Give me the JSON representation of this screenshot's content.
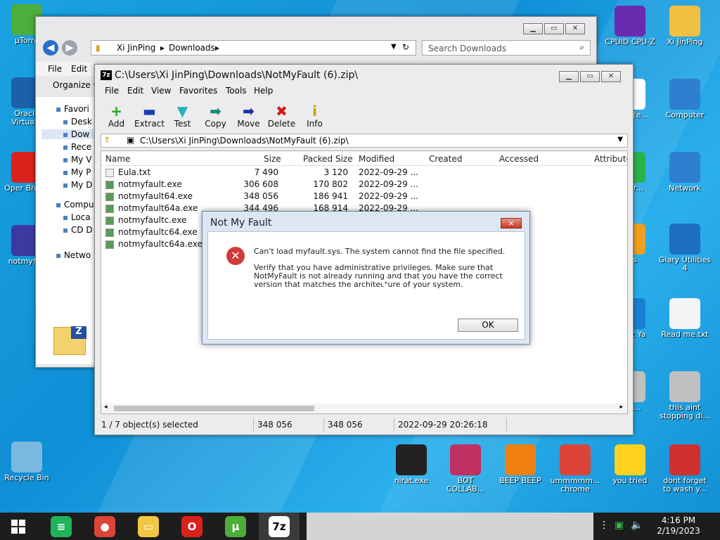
{
  "desktop": {
    "icons_left": [
      {
        "label": "µTorre",
        "icon": "utorrent-icon",
        "color": "#4cae3b"
      },
      {
        "label": "Oracle VirtualB",
        "icon": "virtualbox-icon",
        "color": "#1d5fa8"
      },
      {
        "label": "Oper Brows",
        "icon": "opera-icon",
        "color": "#d9221c"
      },
      {
        "label": "notmyfau",
        "icon": "notmyfault-icon",
        "color": "#3a3aa0"
      },
      {
        "label": "Recycle Bin",
        "icon": "recycle-bin-icon",
        "color": "#7ab8e0"
      }
    ],
    "icons_right": [
      {
        "label": "CPUID CPU-Z",
        "icon": "cpuz-icon",
        "color": "#6a2bb0"
      },
      {
        "label": "Xi JinPing",
        "icon": "user-folder-icon",
        "color": "#f0c040"
      },
      {
        "label": "ware te...",
        "icon": "software-icon",
        "color": "#ffffff"
      },
      {
        "label": "Computer",
        "icon": "computer-icon",
        "color": "#2f7fd0"
      },
      {
        "label": "ed er...",
        "icon": "green-app-icon",
        "color": "#2ab24a"
      },
      {
        "label": "Network",
        "icon": "network-icon",
        "color": "#2f7fd0"
      },
      {
        "label": "this",
        "icon": "orange-app-icon",
        "color": "#f0a020"
      },
      {
        "label": "Glary Utilities 4",
        "icon": "glary-icon",
        "color": "#1d6fc0"
      },
      {
        "label": "at Zit Ya",
        "icon": "blue-app-icon",
        "color": "#1a80d0"
      },
      {
        "label": "Read me.txt",
        "icon": "text-file-icon",
        "color": "#f4f4f4"
      },
      {
        "label": "ULL...",
        "icon": "disc-icon",
        "color": "#c0c0c0"
      },
      {
        "label": "this aint stopping di...",
        "icon": "installer-icon",
        "color": "#c0c0c0"
      }
    ],
    "icons_bottom": [
      {
        "label": "nirat.exe",
        "icon": "skull-icon",
        "color": "#222222"
      },
      {
        "label": "BOT COLLAB...",
        "icon": "bot-collab-icon",
        "color": "#c03060"
      },
      {
        "label": "BEEP BEEP",
        "icon": "vlc-icon",
        "color": "#f08010"
      },
      {
        "label": "ummmmm... chrome",
        "icon": "chrome-icon",
        "color": "#db4437"
      },
      {
        "label": "you tried",
        "icon": "star-icon",
        "color": "#ffd21e"
      },
      {
        "label": "dont forget to wash y...",
        "icon": "ccleaner-icon",
        "color": "#d03030"
      }
    ]
  },
  "explorer": {
    "breadcrumb": [
      "Xi JinPing",
      "Downloads"
    ],
    "search_placeholder": "Search Downloads",
    "menu": [
      "File",
      "Edit"
    ],
    "organize_label": "Organize",
    "nav": [
      {
        "label": "Favori",
        "icon": "star-icon"
      },
      {
        "label": "Desk",
        "icon": "desktop-icon"
      },
      {
        "label": "Dow",
        "icon": "downloads-icon"
      },
      {
        "label": "Rece",
        "icon": "recent-icon"
      },
      {
        "label": "My V",
        "icon": "videos-icon"
      },
      {
        "label": "My P",
        "icon": "pictures-icon"
      },
      {
        "label": "My D",
        "icon": "documents-icon"
      },
      {
        "label": "Compu",
        "icon": "computer-icon"
      },
      {
        "label": "Loca",
        "icon": "drive-icon"
      },
      {
        "label": "CD D",
        "icon": "cd-icon"
      },
      {
        "label": "Netwo",
        "icon": "network-icon"
      }
    ]
  },
  "sevenzip": {
    "title": "C:\\Users\\Xi JinPing\\Downloads\\NotMyFault (6).zip\\",
    "menu": [
      "File",
      "Edit",
      "View",
      "Favorites",
      "Tools",
      "Help"
    ],
    "toolbar": [
      {
        "label": "Add",
        "glyph": "+",
        "color": "#1faa1f",
        "icon": "add-icon"
      },
      {
        "label": "Extract",
        "glyph": "▬",
        "color": "#1a3fb0",
        "icon": "extract-icon"
      },
      {
        "label": "Test",
        "glyph": "▼",
        "color": "#2ab0c0",
        "icon": "test-icon"
      },
      {
        "label": "Copy",
        "glyph": "➡",
        "color": "#1a8a7a",
        "icon": "copy-icon"
      },
      {
        "label": "Move",
        "glyph": "➡",
        "color": "#1a2fa0",
        "icon": "move-icon"
      },
      {
        "label": "Delete",
        "glyph": "✖",
        "color": "#d01818",
        "icon": "delete-icon"
      },
      {
        "label": "Info",
        "glyph": "i",
        "color": "#c8a000",
        "icon": "info-icon"
      }
    ],
    "path": "C:\\Users\\Xi JinPing\\Downloads\\NotMyFault (6).zip\\",
    "columns": [
      "Name",
      "Size",
      "Packed Size",
      "Modified",
      "Created",
      "Accessed",
      "Attribute"
    ],
    "rows": [
      {
        "name": "Eula.txt",
        "size": "7 490",
        "packed": "3 120",
        "modified": "2022-09-29 ..."
      },
      {
        "name": "notmyfault.exe",
        "size": "306 608",
        "packed": "170 802",
        "modified": "2022-09-29 ..."
      },
      {
        "name": "notmyfault64.exe",
        "size": "348 056",
        "packed": "186 941",
        "modified": "2022-09-29 ..."
      },
      {
        "name": "notmyfault64a.exe",
        "size": "344 496",
        "packed": "168 914",
        "modified": "2022-09-29 ..."
      },
      {
        "name": "notmyfaultc.exe",
        "size": "",
        "packed": "",
        "modified": ""
      },
      {
        "name": "notmyfaultc64.exe",
        "size": "",
        "packed": "",
        "modified": ""
      },
      {
        "name": "notmyfaultc64a.exe",
        "size": "",
        "packed": "",
        "modified": ""
      }
    ],
    "status": {
      "selected": "1 / 7 object(s) selected",
      "size": "348 056",
      "packed": "348 056",
      "modified": "2022-09-29 20:26:18"
    }
  },
  "dialog": {
    "title": "Not My Fault",
    "message1": "Can't load myfault.sys. The system cannot find the file specified.",
    "message2": "Verify that you have administrative privileges. Make sure that NotMyFault is not already running and that you have the correct version that matches the architecture of your system.",
    "ok_label": "OK",
    "close_glyph": "✕"
  },
  "taskbar": {
    "clock_time": "4:16 PM",
    "clock_date": "2/19/2023",
    "apps": [
      {
        "name": "sheets-app",
        "color": "#1fb45a",
        "glyph": "≡"
      },
      {
        "name": "chrome-app",
        "color": "#db4437",
        "glyph": "●"
      },
      {
        "name": "explorer-app",
        "color": "#f2c744",
        "glyph": "▭"
      },
      {
        "name": "opera-app",
        "color": "#d9221c",
        "glyph": "O"
      },
      {
        "name": "utorrent-app",
        "color": "#4cae3b",
        "glyph": "µ"
      },
      {
        "name": "sevenzip-app",
        "color": "#ffffff",
        "glyph": "7z"
      }
    ]
  }
}
